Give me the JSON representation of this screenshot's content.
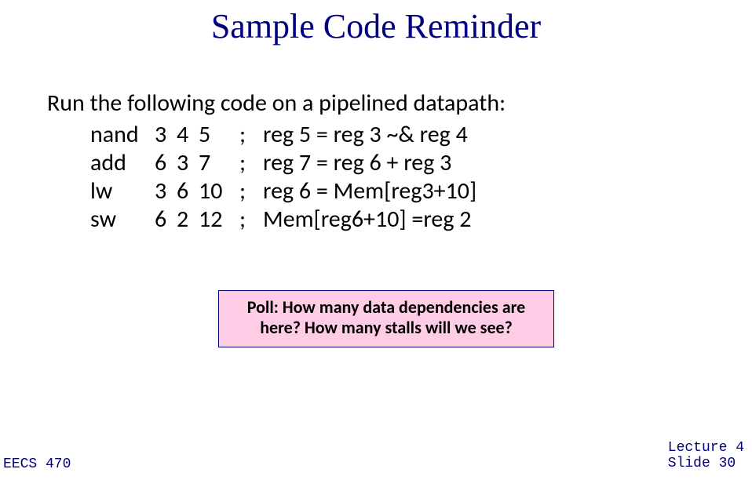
{
  "title": "Sample Code Reminder",
  "intro": "Run the following code on a pipelined datapath:",
  "code": [
    {
      "op": "nand",
      "a1": "3",
      "a2": "4",
      "a3": "5",
      "sep": ";",
      "comment": "reg 5 = reg 3 ~& reg 4"
    },
    {
      "op": "add",
      "a1": "6",
      "a2": "3",
      "a3": "7",
      "sep": ";",
      "comment": "reg 7 = reg 6 + reg 3"
    },
    {
      "op": "lw",
      "a1": "3",
      "a2": "6",
      "a3": "10",
      "sep": ";",
      "comment": "reg 6 =  Mem[reg3+10]"
    },
    {
      "op": "sw",
      "a1": "6",
      "a2": "2",
      "a3": "12",
      "sep": ";",
      "comment": "Mem[reg6+10] =reg 2"
    }
  ],
  "poll": {
    "line1": "Poll: How many data dependencies are",
    "line2": "here? How many stalls will we see?"
  },
  "footer": {
    "left": "EECS 470",
    "right_line1": "Lecture 4",
    "right_line2": "Slide 30"
  }
}
